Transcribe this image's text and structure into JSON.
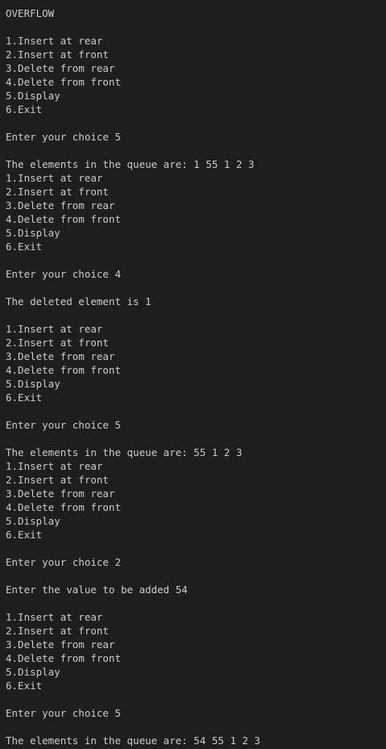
{
  "terminal": {
    "background": "#1e1e1e",
    "foreground": "#cccccc",
    "lines": [
      "OVERFLOW",
      "",
      "1.Insert at rear",
      "2.Insert at front",
      "3.Delete from rear",
      "4.Delete from front",
      "5.Display",
      "6.Exit",
      "",
      "Enter your choice 5",
      "",
      "The elements in the queue are: 1 55 1 2 3",
      "1.Insert at rear",
      "2.Insert at front",
      "3.Delete from rear",
      "4.Delete from front",
      "5.Display",
      "6.Exit",
      "",
      "Enter your choice 4",
      "",
      "The deleted element is 1",
      "",
      "1.Insert at rear",
      "2.Insert at front",
      "3.Delete from rear",
      "4.Delete from front",
      "5.Display",
      "6.Exit",
      "",
      "Enter your choice 5",
      "",
      "The elements in the queue are: 55 1 2 3",
      "1.Insert at rear",
      "2.Insert at front",
      "3.Delete from rear",
      "4.Delete from front",
      "5.Display",
      "6.Exit",
      "",
      "Enter your choice 2",
      "",
      "Enter the value to be added 54",
      "",
      "1.Insert at rear",
      "2.Insert at front",
      "3.Delete from rear",
      "4.Delete from front",
      "5.Display",
      "6.Exit",
      "",
      "Enter your choice 5",
      "",
      "The elements in the queue are: 54 55 1 2 3"
    ]
  }
}
